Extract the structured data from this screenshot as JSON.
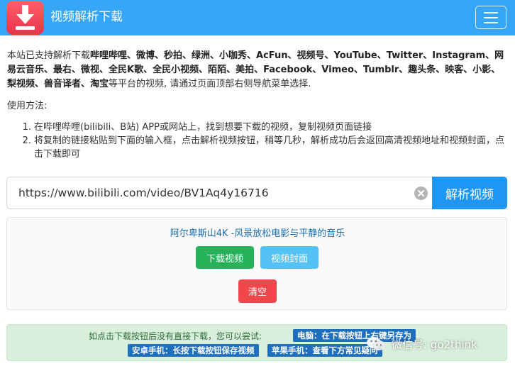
{
  "header": {
    "brand": "视频解析下载"
  },
  "intro": {
    "prefix": "本站已支持解析下载",
    "platforms": "哔哩哔哩、微博、秒拍、绿洲、小咖秀、AcFun、视频号、YouTube、Twitter、Instagram、网易云音乐、最右、微视、全民K歌、全民小视频、陌陌、美拍、Facebook、Vimeo、Tumblr、趣头条、映客、小影、梨视频、兽音译者、淘宝",
    "suffix": "等平台的视频, 请通过页面顶部右侧导航菜单选择."
  },
  "usage": {
    "title": "使用方法:",
    "steps": [
      {
        "num": "1.",
        "text": "在哔哩哔哩(bilibili、B站) APP或网站上，找到想要下载的视频，复制视频页面链接"
      },
      {
        "num": "2.",
        "text": "将复制的链接粘贴到下面的输入框，点击解析视频按钮，稍等几秒，解析成功后会返回高清视频地址和视频封面，点击下载即可"
      }
    ]
  },
  "search": {
    "value": "https://www.bilibili.com/video/BV1Aq4y16716",
    "button": "解析视频"
  },
  "result": {
    "title": "阿尔卑斯山4K -风景放松电影与平静的音乐",
    "download": "下载视频",
    "cover": "视频封面",
    "clear": "清空"
  },
  "hint": {
    "line1": "如点击下载按钮后没有直接下载，您可以尝试:",
    "tags": [
      "电脑：在下载按钮上右键另存为",
      "安卓手机：长按下载按钮保存视频",
      "苹果手机：查看下方常见疑问"
    ]
  },
  "watermark": "微信号: go2think",
  "colors": {
    "navbar": "#36a6f8",
    "primary": "#1e96f5",
    "success": "#28b15b",
    "info": "#55c2f6",
    "danger": "#f0474d"
  }
}
